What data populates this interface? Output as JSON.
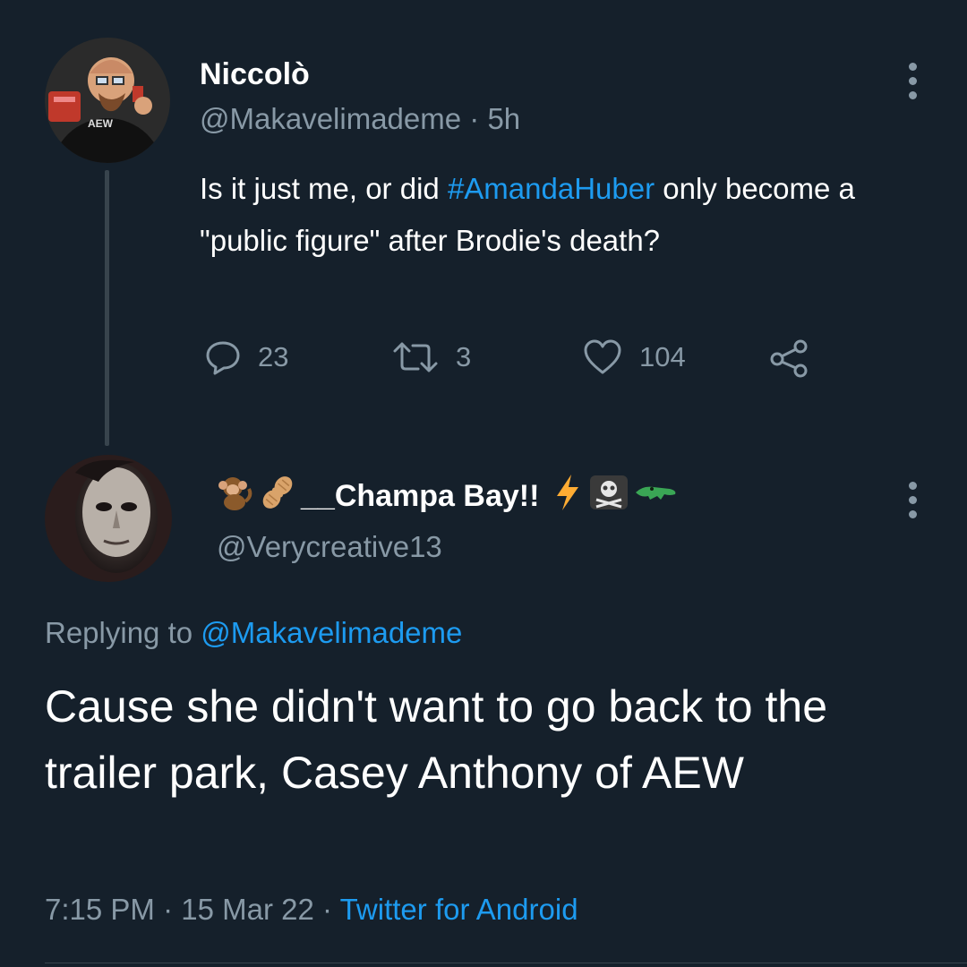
{
  "colors": {
    "background": "#15202b",
    "text": "#ffffff",
    "muted": "#8899a6",
    "link": "#1d9bf0",
    "divider": "#38444d"
  },
  "tweet1": {
    "display_name": "Niccolò",
    "handle": "@Makavelimademe",
    "separator": "·",
    "time": "5h",
    "text_before": "Is it just me, or did ",
    "hashtag": "#AmandaHuber",
    "text_after": " only become a \"public figure\" after Brodie's death?",
    "reply_count": "23",
    "retweet_count": "3",
    "like_count": "104",
    "avatar_text": "AEW",
    "icons": [
      "reply-icon",
      "retweet-icon",
      "like-icon",
      "share-icon",
      "more-icon"
    ]
  },
  "tweet2": {
    "display_name": "__Champa Bay!!",
    "name_emoji": [
      "monkey-emoji",
      "peanut-emoji",
      "lightning-emoji",
      "skull-crossbones-emoji",
      "crocodile-emoji"
    ],
    "handle": "@Verycreative13",
    "replying_prefix": "Replying to ",
    "replying_handle": "@Makavelimademe",
    "text": "Cause she didn't want to go back to the trailer park, Casey Anthony of AEW",
    "time": "7:15 PM",
    "separator": "·",
    "date": "15 Mar 22",
    "source": "Twitter for Android"
  }
}
